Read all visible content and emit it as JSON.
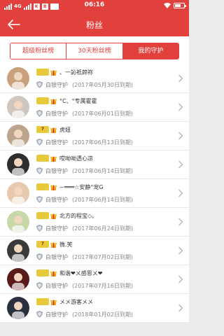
{
  "statusbar": {
    "network": "4G",
    "badges": [
      "K",
      "B"
    ],
    "time": "06:16",
    "battery_level": 0.7
  },
  "header": {
    "title": "粉丝"
  },
  "tabs": [
    {
      "label": "超级粉丝榜",
      "active": false
    },
    {
      "label": "30天粉丝榜",
      "active": false
    },
    {
      "label": "我的守护",
      "active": true
    }
  ],
  "guards": [
    {
      "level": "",
      "nickname": "、一訫祗鍗祢",
      "guard": "白银守护",
      "expire": "(2017年05月30日到期)",
      "avatar_color": "#c9a27d"
    },
    {
      "level": "",
      "nickname": "°C、°专属霍霍",
      "guard": "白银守护",
      "expire": "(2017年06月01日到期)",
      "avatar_color": "#cfc6be"
    },
    {
      "level": "7",
      "nickname": "虎妞",
      "guard": "白银守护",
      "expire": "(2017年06月13日到期)",
      "avatar_color": "#bda48c"
    },
    {
      "level": "",
      "nickname": "哎呦呦透心凉",
      "guard": "白银守护",
      "expire": "(2017年06月14日到期)",
      "avatar_color": "#2e2e2e"
    },
    {
      "level": "",
      "nickname": "~═══☆安静°宠G",
      "guard": "白银守护",
      "expire": "(2017年06月14日到期)",
      "avatar_color": "#e7c9b0"
    },
    {
      "level": "",
      "nickname": "北方的程宝◇。",
      "guard": "白银守护",
      "expire": "(2017年06月24日到期)",
      "avatar_color": "#c7d7a8"
    },
    {
      "level": "7",
      "nickname": "微.笑",
      "guard": "白银守护",
      "expire": "(2017年07月02日到期)",
      "avatar_color": "#3a3a3a"
    },
    {
      "level": "",
      "nickname": "和谐❤ㄨ感恩ㄨ❤",
      "guard": "白银守护",
      "expire": "(2017年07月16日到期)",
      "avatar_color": "#5a1a1a"
    },
    {
      "level": "",
      "nickname": "メメ游客メメ",
      "guard": "白银守护",
      "expire": "(2018年01月02日到期)",
      "avatar_color": "#2a3040"
    }
  ]
}
